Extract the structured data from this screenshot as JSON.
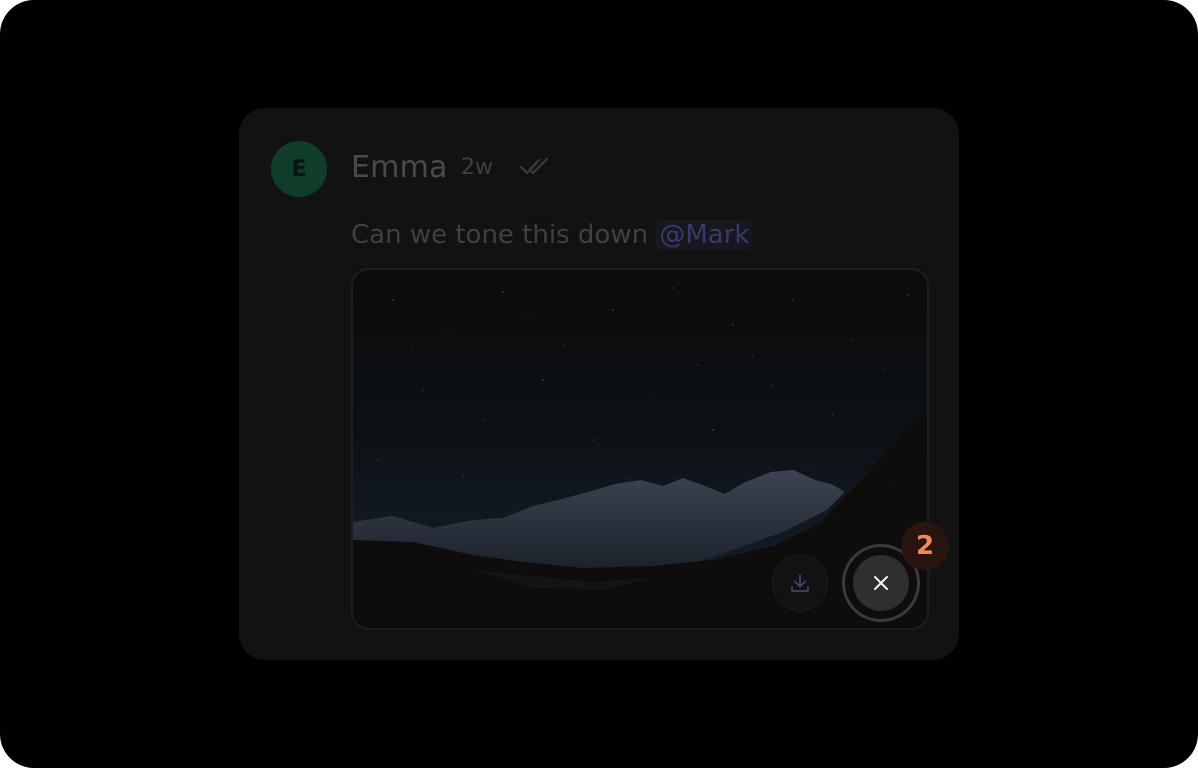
{
  "comment": {
    "avatar_initial": "E",
    "author": "Emma",
    "time_ago": "2w",
    "status_icon": "double-check-icon",
    "message_text": "Can we tone this down ",
    "mention": "@Mark"
  },
  "attachment": {
    "image_subject": "snowy mountains under a starry night sky",
    "download_icon": "download-icon",
    "close_icon": "close-icon",
    "step_badge": "2"
  },
  "colors": {
    "avatar_bg": "#0f3d2a",
    "mention": "#3a3a6a",
    "badge_text": "#f08a5a",
    "badge_bg": "#2a1410"
  }
}
